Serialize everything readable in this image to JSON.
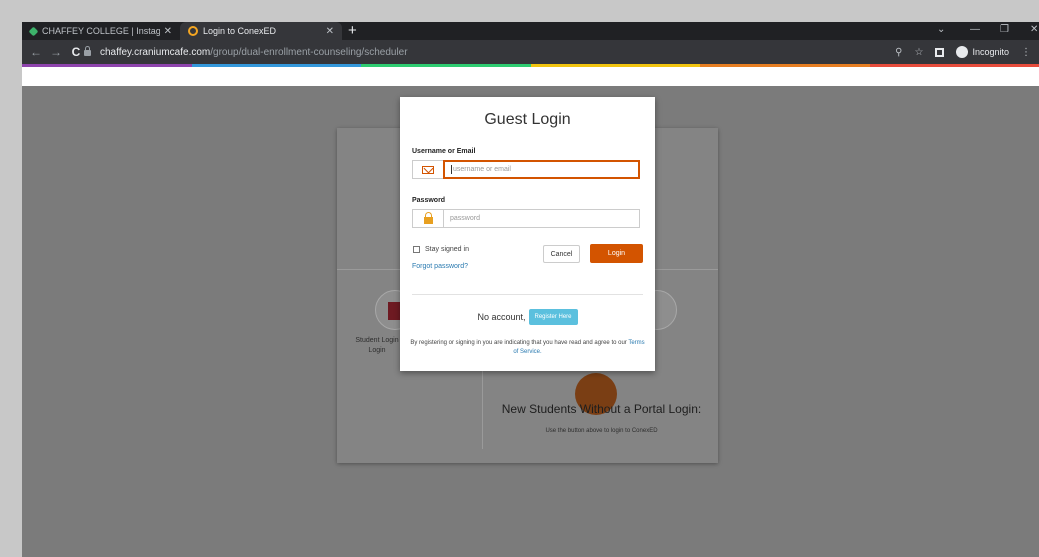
{
  "browser": {
    "tabs": [
      {
        "title": "CHAFFEY COLLEGE | Instagram |",
        "active": false
      },
      {
        "title": "Login to ConexED",
        "active": true
      }
    ],
    "new_tab_label": "+",
    "url_host": "chaffey.craniumcafe.com",
    "url_path": "/group/dual-enrollment-counseling/scheduler",
    "incognito_label": "Incognito"
  },
  "rainbow_colors": [
    "#8e44ad",
    "#3498db",
    "#2ecc71",
    "#f1c40f",
    "#e67e22",
    "#e74c3c"
  ],
  "background_page": {
    "student_login_text": "Student Login Login",
    "heading": "New Students Without a Portal Login:",
    "subtext": "Use the button above to login to ConexED"
  },
  "modal": {
    "title": "Guest Login",
    "username_label": "Username or Email",
    "username_placeholder": "username or email",
    "password_label": "Password",
    "password_placeholder": "password",
    "stay_signed_in": "Stay signed in",
    "forgot_password": "Forgot password?",
    "cancel": "Cancel",
    "login": "Login",
    "no_account": "No account,",
    "register": "Register Here",
    "terms_prefix": "By registering or signing in you are indicating that you have read and agree to our",
    "terms_link": "Terms of Service.",
    "accent_color": "#d35400",
    "register_color": "#5bc0de"
  }
}
